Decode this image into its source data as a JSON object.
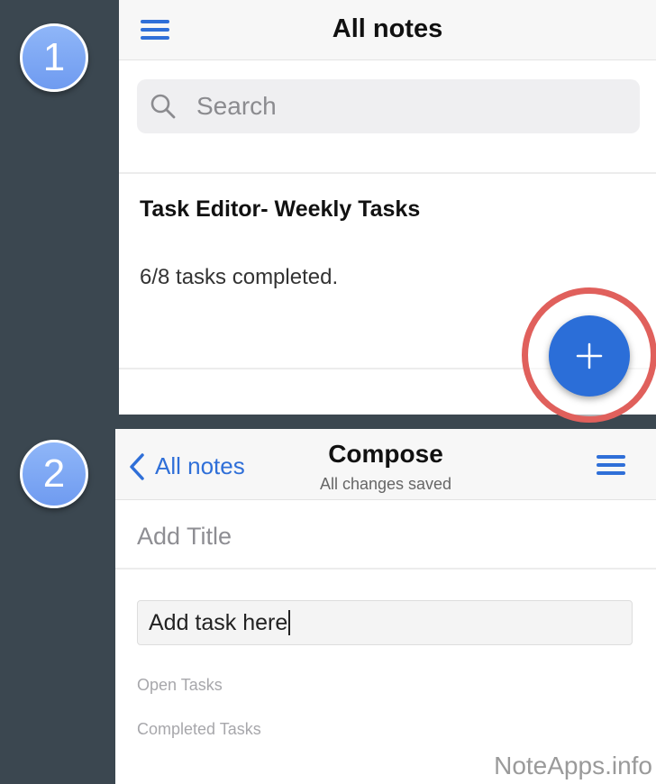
{
  "steps": {
    "first": "1",
    "second": "2"
  },
  "notes_list": {
    "title": "All notes",
    "search_placeholder": "Search",
    "notes": [
      {
        "title": "Task Editor- Weekly Tasks",
        "summary": "6/8 tasks completed."
      }
    ],
    "fab_symbol": "+"
  },
  "compose": {
    "back_label": "All notes",
    "title": "Compose",
    "subtitle": "All changes saved",
    "title_placeholder": "Add Title",
    "task_input_value": "Add task here",
    "open_tasks_label": "Open Tasks",
    "completed_tasks_label": "Completed Tasks"
  },
  "watermark": "NoteApps.info",
  "icons": [
    "menu-icon",
    "search-icon",
    "plus-icon",
    "chevron-left-icon"
  ],
  "colors": {
    "accent": "#2f6fd8",
    "fab": "#2b6ed8",
    "highlight_ring": "#e0605c",
    "badge": "#7aa6f5",
    "backdrop": "#3b4750"
  }
}
